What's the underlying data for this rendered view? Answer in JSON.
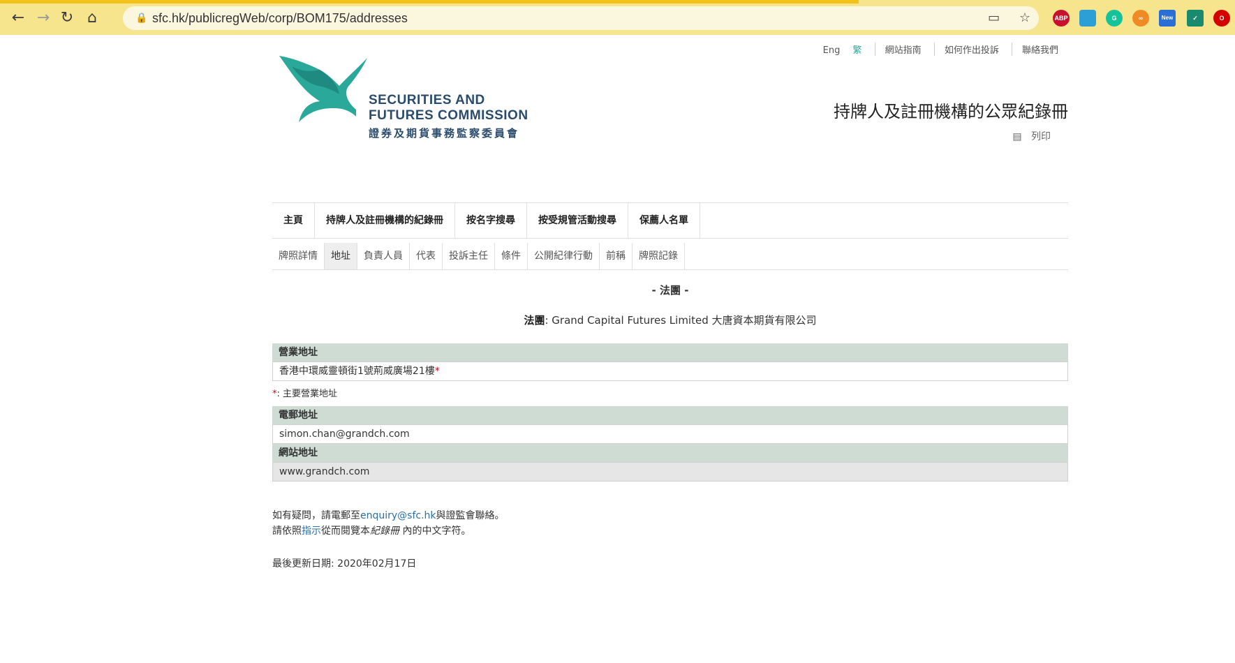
{
  "browser": {
    "url": "sfc.hk/publicregWeb/corp/BOM175/addresses",
    "extensions": [
      "ABP",
      "New"
    ]
  },
  "header": {
    "lang_eng": "Eng",
    "lang_trad": "繁",
    "links": [
      "網站指南",
      "如何作出投訴",
      "聯絡我們"
    ],
    "logo_en_line1": "SECURITIES AND",
    "logo_en_line2": "FUTURES COMMISSION",
    "logo_zh": "證券及期貨事務監察委員會",
    "site_title": "持牌人及註冊機構的公眾紀錄冊",
    "print_label": "列印"
  },
  "mainnav": [
    "主頁",
    "持牌人及註冊機構的紀錄冊",
    "按名字搜尋",
    "按受規管活動搜尋",
    "保薦人名單"
  ],
  "subnav": {
    "items": [
      "牌照詳情",
      "地址",
      "負責人員",
      "代表",
      "投訴主任",
      "條件",
      "公開紀律行動",
      "前稱",
      "牌照記錄"
    ],
    "active_index": 1
  },
  "content": {
    "section_title": "- 法團 -",
    "corp_label": "法團",
    "corp_name": ": Grand Capital Futures Limited 大唐資本期貨有限公司",
    "business_address_header": "營業地址",
    "business_address": "香港中環威靈頓街1號荊威廣場21樓",
    "required_mark": "*",
    "note_text": ": 主要營業地址",
    "email_header": "電郵地址",
    "email": "simon.chan@grandch.com",
    "website_header": "網站地址",
    "website": "www.grandch.com"
  },
  "footer": {
    "line1_prefix": "如有疑問，請電郵至",
    "line1_email": "enquiry@sfc.hk",
    "line1_suffix": "與證監會聯絡。",
    "line2_prefix": "請依照",
    "line2_link": "指示",
    "line2_mid": "從而閱覽本",
    "line2_italic": "紀錄冊",
    "line2_suffix": " 內的中文字符。",
    "updated": "最後更新日期: 2020年02月17日"
  },
  "colors": {
    "chrome": "#f6e58d",
    "table_header": "#cfdcd4",
    "logo_teal": "#2aa89a",
    "link": "#2a6fa8"
  }
}
